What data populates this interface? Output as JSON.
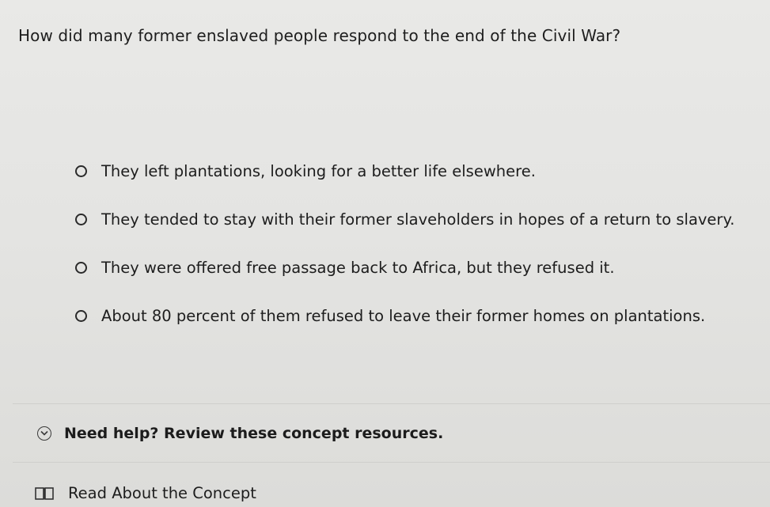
{
  "question": {
    "text": "How did many former enslaved people respond to the end of the Civil War?"
  },
  "options": [
    {
      "label": "They left plantations, looking for a better life elsewhere.",
      "selected": false
    },
    {
      "label": "They tended to stay with their former slaveholders in hopes of a return to slavery.",
      "selected": false
    },
    {
      "label": "They were offered free passage back to Africa, but they refused it.",
      "selected": false
    },
    {
      "label": "About 80 percent of them refused to leave their former homes on plantations.",
      "selected": false
    }
  ],
  "help": {
    "label": "Need help? Review these concept resources.",
    "icon": "chevron-down-circle-icon"
  },
  "resources": [
    {
      "label": "Read About the Concept",
      "icon": "book-icon"
    }
  ]
}
